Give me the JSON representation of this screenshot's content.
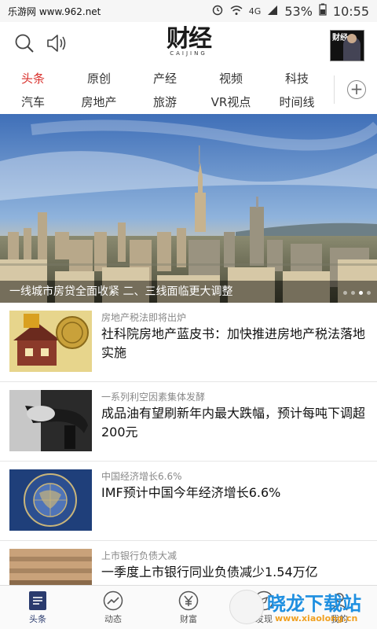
{
  "statusbar": {
    "site": "乐游网 www.962.net",
    "network": "4G",
    "battery": "53%",
    "time": "10:55"
  },
  "header": {
    "logo_cn": "财经",
    "logo_en": "CAIJING",
    "cover_title": "财经"
  },
  "tabs": {
    "row1": [
      "头条",
      "原创",
      "产经",
      "视频",
      "科技"
    ],
    "row2": [
      "汽车",
      "房地产",
      "旅游",
      "VR视点",
      "时间线"
    ],
    "active": "头条",
    "plus": "+"
  },
  "hero": {
    "caption": "一线城市房贷全面收紧 二、三线面临更大调整"
  },
  "news": [
    {
      "tag": "房地产税法即将出炉",
      "title": "社科院房地产蓝皮书：加快推进房地产税法落地实施"
    },
    {
      "tag": "一系列利空因素集体发酵",
      "title": "成品油有望刷新年内最大跌幅，预计每吨下调超200元"
    },
    {
      "tag": "中国经济增长6.6%",
      "title": "IMF预计中国今年经济增长6.6%"
    },
    {
      "tag": "上市银行负债大减",
      "title": "一季度上市银行同业负债减少1.54万亿"
    }
  ],
  "bottomnav": [
    {
      "label": "头条",
      "icon": "news-icon"
    },
    {
      "label": "动态",
      "icon": "trend-icon"
    },
    {
      "label": "财富",
      "icon": "yuan-icon"
    },
    {
      "label": "发现",
      "icon": "discover-icon"
    },
    {
      "label": "我的",
      "icon": "user-icon"
    }
  ],
  "watermark": {
    "text": "晓龙下载站",
    "url": "www.xiaolong.cn"
  },
  "colors": {
    "accent": "#d9302c",
    "navy": "#2a3b6e"
  }
}
